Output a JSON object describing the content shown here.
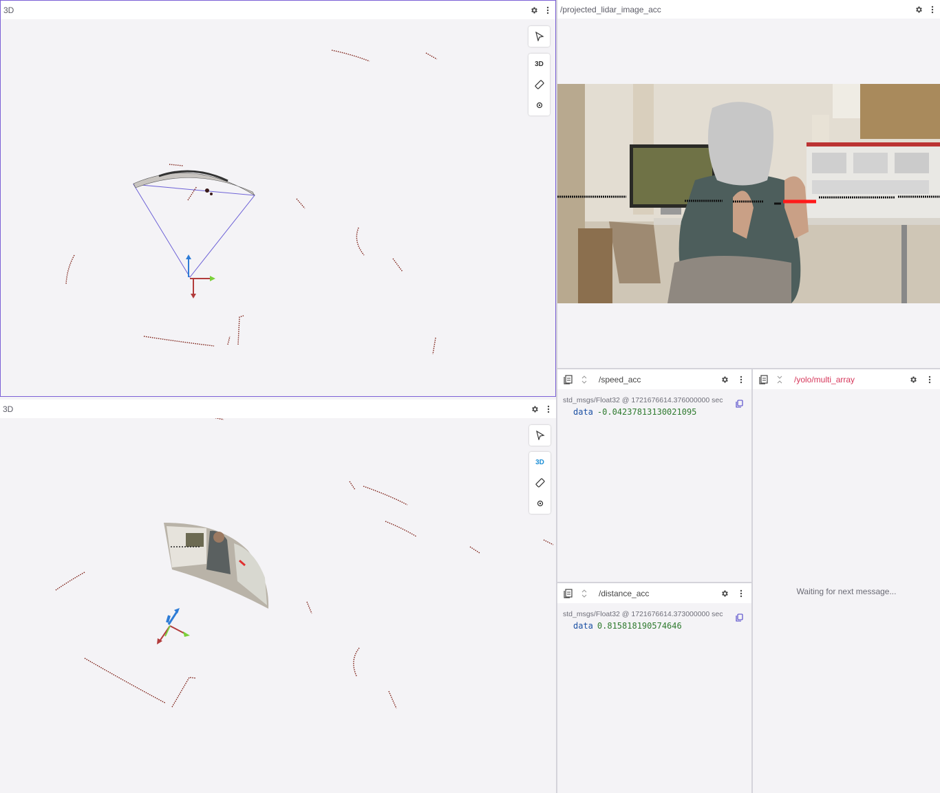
{
  "panels": {
    "top3d": {
      "title": "3D"
    },
    "bottom3d": {
      "title": "3D"
    },
    "image": {
      "title": "/projected_lidar_image_acc"
    },
    "speed": {
      "topic": "/speed_acc",
      "meta": "std_msgs/Float32 @ 1721676614.376000000 sec",
      "data_key": "data",
      "data_value": "-0.04237813130021095"
    },
    "distance": {
      "topic": "/distance_acc",
      "meta": "std_msgs/Float32 @ 1721676614.373000000 sec",
      "data_key": "data",
      "data_value": "0.815818190574646"
    },
    "yolo": {
      "topic": "/yolo/multi_array",
      "waiting": "Waiting for next message..."
    }
  },
  "side_tools": {
    "label_3d": "3D"
  },
  "colors": {
    "accent": "#7b5fd6",
    "error_topic": "#d6365a",
    "data_value": "#2e7a2e",
    "data_key": "#1a4fa3",
    "lidar_points": "#7a1a10",
    "red_overlay": "#ff1a1a"
  }
}
